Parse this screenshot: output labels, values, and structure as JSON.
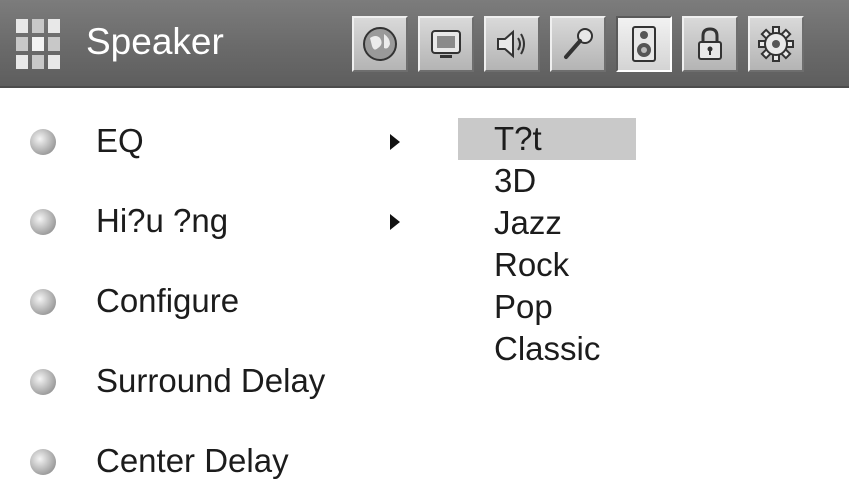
{
  "header": {
    "title": "Speaker",
    "tabs": [
      {
        "icon": "globe-icon",
        "active": false
      },
      {
        "icon": "tv-icon",
        "active": false
      },
      {
        "icon": "audio-icon",
        "active": false
      },
      {
        "icon": "microphone-icon",
        "active": false
      },
      {
        "icon": "speaker-icon",
        "active": true
      },
      {
        "icon": "lock-icon",
        "active": false
      },
      {
        "icon": "gear-icon",
        "active": false
      }
    ]
  },
  "menu": {
    "items": [
      {
        "label": "EQ",
        "has_submenu": true
      },
      {
        "label": "Hi?u ?ng",
        "has_submenu": true
      },
      {
        "label": "Configure",
        "has_submenu": false
      },
      {
        "label": "Surround Delay",
        "has_submenu": false
      },
      {
        "label": "Center Delay",
        "has_submenu": false
      }
    ]
  },
  "submenu": {
    "items": [
      "T?t",
      "3D",
      "Jazz",
      "Rock",
      "Pop",
      "Classic"
    ],
    "selected_index": 0
  },
  "colors": {
    "title_bar": "#6f6f6f",
    "title_text": "#ffffff",
    "selected_highlight": "#c9c9c9",
    "text": "#1c1c1c"
  }
}
